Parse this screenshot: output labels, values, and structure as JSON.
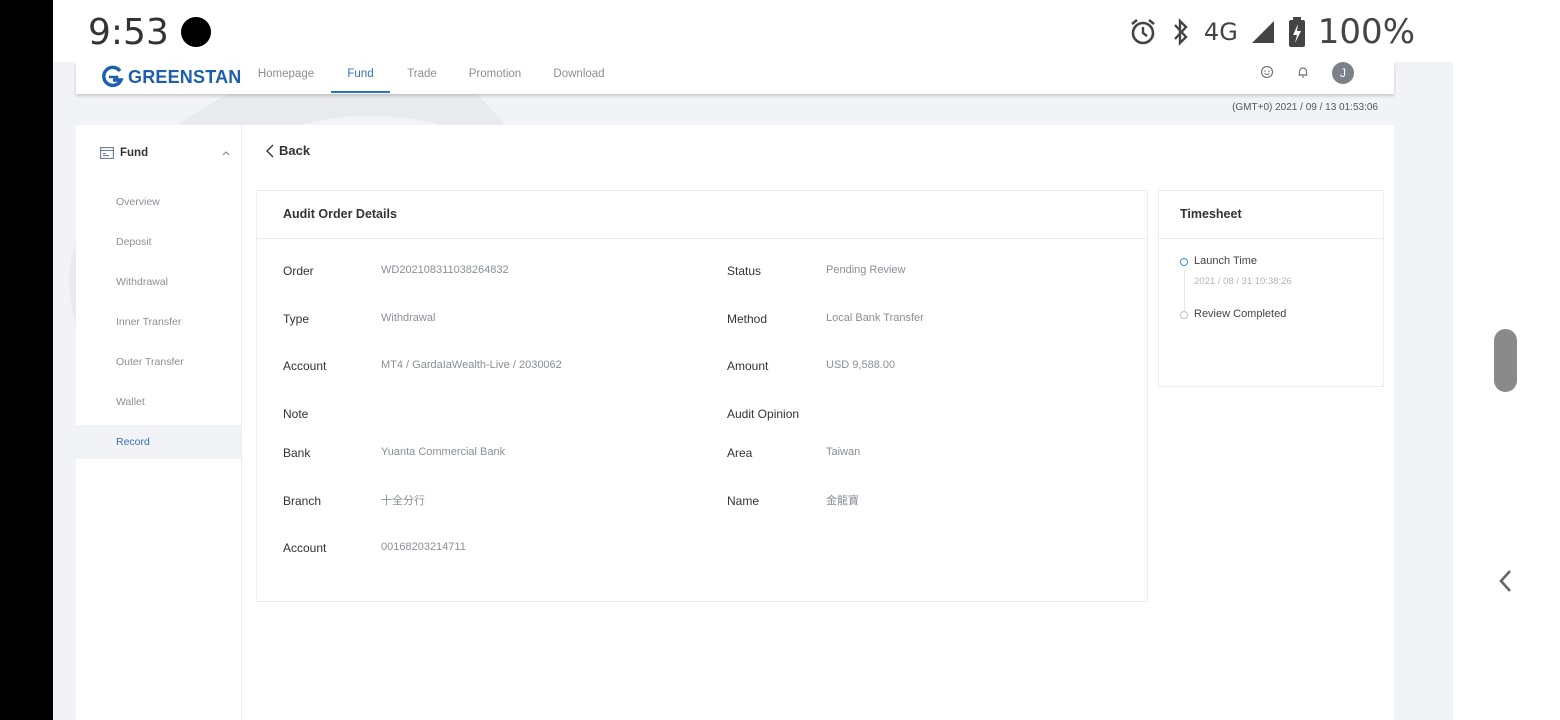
{
  "status_bar": {
    "time": "9:53",
    "network": "4G",
    "battery": "100%",
    "icons": [
      "alarm-icon",
      "bluetooth-icon",
      "signal-icon",
      "battery-icon"
    ]
  },
  "brand": {
    "name": "GREENSTAN",
    "color": "#1c5fae"
  },
  "nav": {
    "items": [
      {
        "label": "Homepage"
      },
      {
        "label": "Fund"
      },
      {
        "label": "Trade"
      },
      {
        "label": "Promotion"
      },
      {
        "label": "Download"
      }
    ],
    "active": "Fund",
    "avatar_initial": "J",
    "accent": "#2f73c0"
  },
  "timezone_clock": "(GMT+0) 2021 / 09 / 13 01:53:06",
  "sidebar": {
    "section": "Fund",
    "items": [
      {
        "label": "Overview"
      },
      {
        "label": "Deposit"
      },
      {
        "label": "Withdrawal"
      },
      {
        "label": "Inner Transfer"
      },
      {
        "label": "Outer Transfer"
      },
      {
        "label": "Wallet"
      },
      {
        "label": "Record"
      }
    ],
    "active": "Record"
  },
  "back_label": "Back",
  "audit": {
    "title": "Audit Order Details",
    "left_fields": [
      {
        "label": "Order",
        "value": "WD202108311038264832"
      },
      {
        "label": "Type",
        "value": "Withdrawal"
      },
      {
        "label": "Account",
        "value": "MT4 / GardaIaWealth-Live / 2030062"
      },
      {
        "label": "Note",
        "value": ""
      },
      {
        "label": "Bank",
        "value": "Yuanta Commercial Bank"
      },
      {
        "label": "Branch",
        "value": "十全分行"
      },
      {
        "label": "Account",
        "value": "00168203214711"
      }
    ],
    "right_fields": [
      {
        "label": "Status",
        "value": "Pending Review"
      },
      {
        "label": "Method",
        "value": "Local Bank Transfer"
      },
      {
        "label": "Amount",
        "value": "USD 9,588.00"
      },
      {
        "label": "Audit Opinion",
        "value": ""
      },
      {
        "label": "Area",
        "value": "Taiwan"
      },
      {
        "label": "Name",
        "value": "金龍寶"
      }
    ]
  },
  "timesheet": {
    "title": "Timesheet",
    "events": [
      {
        "label": "Launch Time",
        "time": "2021 / 08 / 31 10:38:26",
        "done": true
      },
      {
        "label": "Review Completed",
        "time": "",
        "done": false
      }
    ]
  }
}
